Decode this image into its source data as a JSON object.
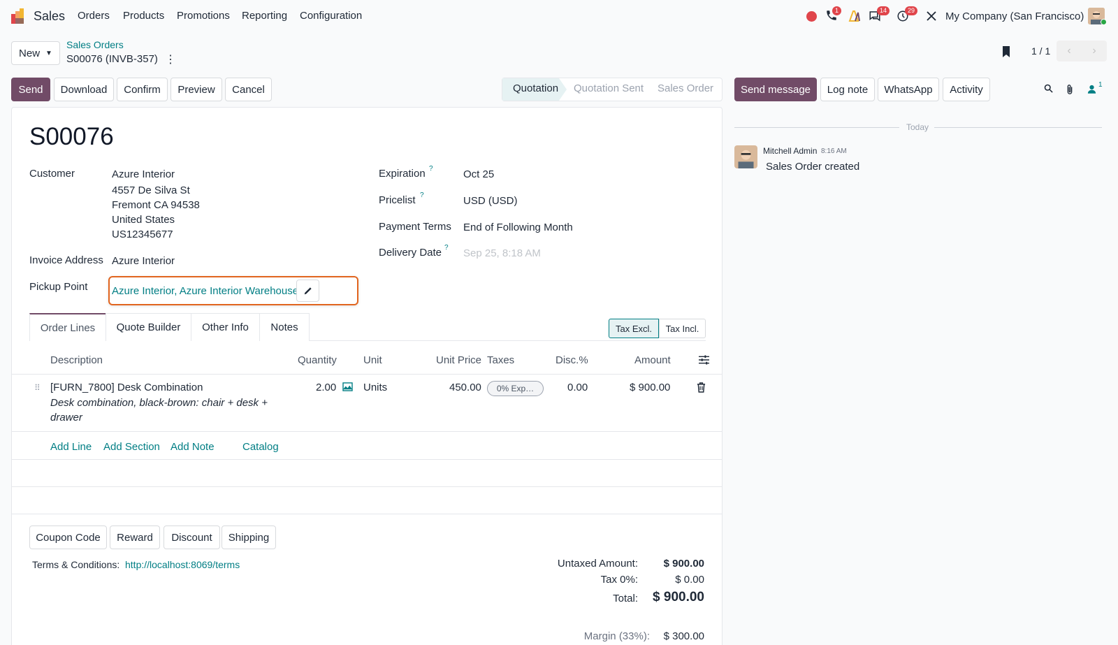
{
  "topbar": {
    "app_name": "Sales",
    "menu": [
      "Orders",
      "Products",
      "Promotions",
      "Reporting",
      "Configuration"
    ],
    "badges": {
      "calls": "1",
      "messages": "14",
      "activities": "29"
    },
    "company": "My Company (San Francisco)"
  },
  "control": {
    "new_label": "New",
    "breadcrumb_parent": "Sales Orders",
    "record_name": "S00076 (INVB-357)",
    "pager": "1 / 1"
  },
  "actions": {
    "send": "Send",
    "download": "Download",
    "confirm": "Confirm",
    "preview": "Preview",
    "cancel": "Cancel"
  },
  "statusbar": {
    "stages": [
      "Quotation",
      "Quotation Sent",
      "Sales Order"
    ],
    "current": "Quotation"
  },
  "chatter_buttons": {
    "send_message": "Send message",
    "log_note": "Log note",
    "whatsapp": "WhatsApp",
    "activity": "Activity",
    "followers_count": "1"
  },
  "form": {
    "title": "S00076",
    "customer_label": "Customer",
    "customer_lines": [
      "Azure Interior",
      "4557 De Silva St",
      "Fremont CA 94538",
      "United States",
      "US12345677"
    ],
    "invoice_address_label": "Invoice Address",
    "invoice_address": "Azure Interior",
    "pickup_point_label": "Pickup Point",
    "pickup_point": "Azure Interior, Azure Interior Warehouse",
    "expiration_label": "Expiration",
    "expiration": "Oct 25",
    "pricelist_label": "Pricelist",
    "pricelist": "USD (USD)",
    "payment_terms_label": "Payment Terms",
    "payment_terms": "End of Following Month",
    "delivery_date_label": "Delivery Date",
    "delivery_date_placeholder": "Sep 25, 8:18 AM",
    "help_mark": "?"
  },
  "tabs": [
    "Order Lines",
    "Quote Builder",
    "Other Info",
    "Notes"
  ],
  "tax_toggle": {
    "excl": "Tax Excl.",
    "incl": "Tax Incl."
  },
  "lines": {
    "headers": {
      "description": "Description",
      "quantity": "Quantity",
      "unit": "Unit",
      "unit_price": "Unit Price",
      "taxes": "Taxes",
      "disc": "Disc.%",
      "amount": "Amount"
    },
    "rows": [
      {
        "product": "[FURN_7800] Desk Combination",
        "note_line1": "Desk combination, black-brown: chair + desk +",
        "note_line2": "drawer",
        "quantity": "2.00",
        "unit": "Units",
        "unit_price": "450.00",
        "tax": "0% Exp…",
        "disc": "0.00",
        "amount": "$ 900.00"
      }
    ],
    "add_line": "Add Line",
    "add_section": "Add Section",
    "add_note": "Add Note",
    "catalog": "Catalog"
  },
  "footer_buttons": {
    "coupon": "Coupon Code",
    "reward": "Reward",
    "discount": "Discount",
    "shipping": "Shipping"
  },
  "terms": {
    "label": "Terms & Conditions:",
    "link": "http://localhost:8069/terms"
  },
  "totals": {
    "untaxed_label": "Untaxed Amount:",
    "untaxed": "$ 900.00",
    "tax_label": "Tax 0%:",
    "tax": "$ 0.00",
    "total_label": "Total:",
    "total": "$ 900.00",
    "margin_label": "Margin (33%):",
    "margin": "$ 300.00"
  },
  "chatter": {
    "date_separator": "Today",
    "author": "Mitchell Admin",
    "time": "8:16 AM",
    "message": "Sales Order created"
  },
  "colors": {
    "brand": "#714b67",
    "link": "#017e84",
    "highlight": "#e1651f"
  }
}
